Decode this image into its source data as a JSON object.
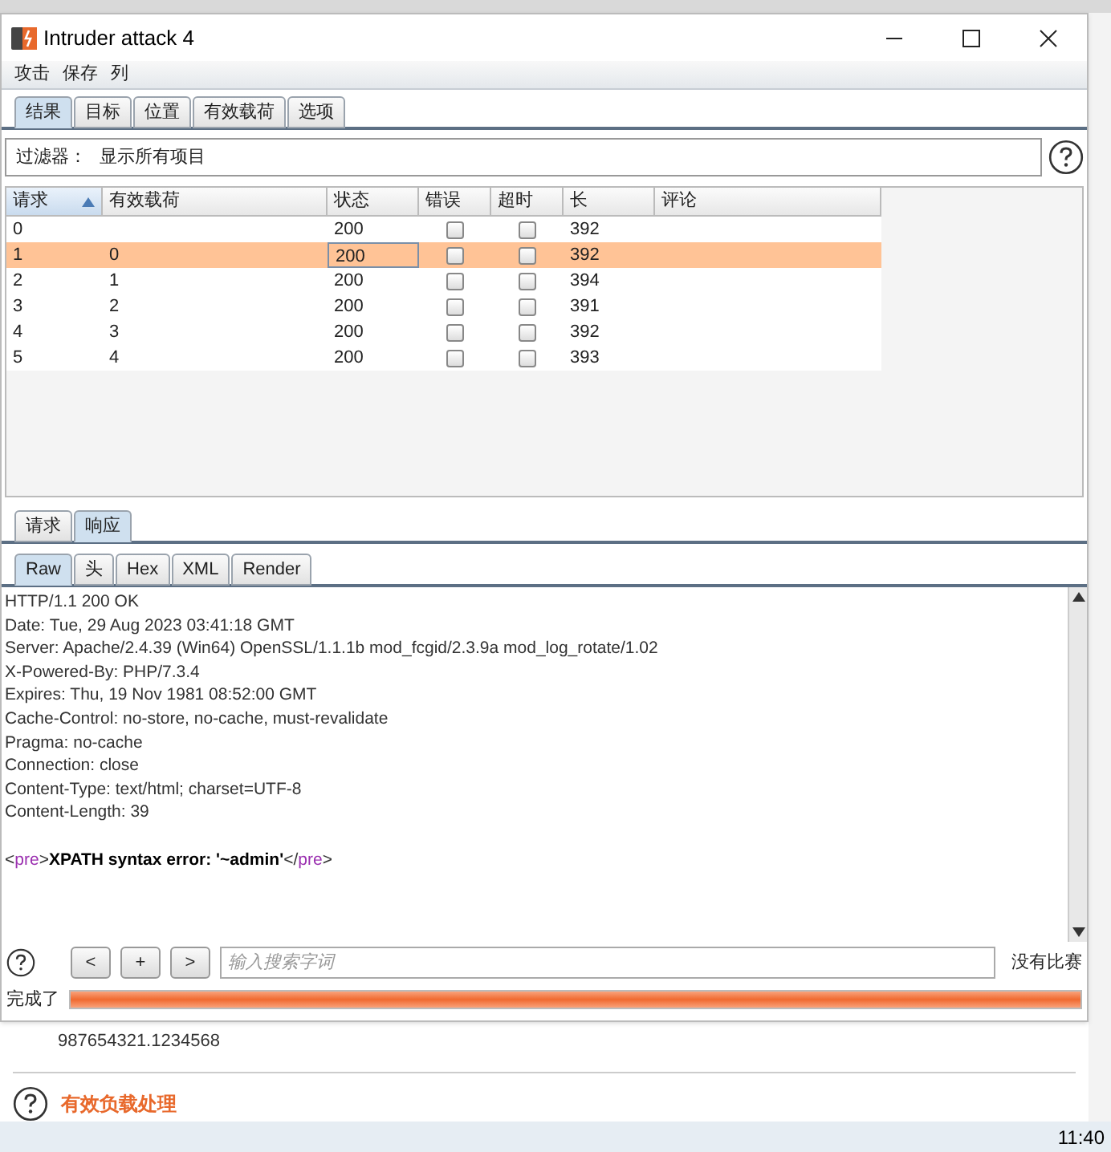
{
  "window": {
    "title": "Intruder attack 4"
  },
  "menu": [
    "攻击",
    "保存",
    "列"
  ],
  "tabs": [
    {
      "label": "结果",
      "selected": true
    },
    {
      "label": "目标",
      "selected": false
    },
    {
      "label": "位置",
      "selected": false
    },
    {
      "label": "有效载荷",
      "selected": false
    },
    {
      "label": "选项",
      "selected": false
    }
  ],
  "filter": {
    "label": "过滤器：",
    "value": "显示所有项目"
  },
  "table": {
    "columns": [
      {
        "label": "请求",
        "sorted": true
      },
      {
        "label": "有效载荷",
        "sorted": false
      },
      {
        "label": "状态",
        "sorted": false
      },
      {
        "label": "错误",
        "sorted": false
      },
      {
        "label": "超时",
        "sorted": false
      },
      {
        "label": "长",
        "sorted": false
      },
      {
        "label": "评论",
        "sorted": false
      }
    ],
    "rows": [
      {
        "request": "0",
        "status": "200",
        "error": false,
        "timeout": false,
        "length": "392",
        "selected": false
      },
      {
        "request": "1",
        "payload": "0",
        "status": "200",
        "error": false,
        "timeout": false,
        "length": "392",
        "selected": true
      },
      {
        "request": "2",
        "payload": "1",
        "status": "200",
        "error": false,
        "timeout": false,
        "length": "394",
        "selected": false
      },
      {
        "request": "3",
        "payload": "2",
        "status": "200",
        "error": false,
        "timeout": false,
        "length": "391",
        "selected": false
      },
      {
        "request": "4",
        "payload": "3",
        "status": "200",
        "error": false,
        "timeout": false,
        "length": "392",
        "selected": false
      },
      {
        "request": "5",
        "payload": "4",
        "status": "200",
        "error": false,
        "timeout": false,
        "length": "393",
        "selected": false
      }
    ]
  },
  "message_tabs": [
    {
      "label": "请求",
      "selected": false
    },
    {
      "label": "响应",
      "selected": true
    }
  ],
  "view_tabs": [
    {
      "label": "Raw",
      "selected": true
    },
    {
      "label": "头",
      "selected": false
    },
    {
      "label": "Hex",
      "selected": false
    },
    {
      "label": "XML",
      "selected": false
    },
    {
      "label": "Render",
      "selected": false
    }
  ],
  "response": [
    {
      "kind": "plain",
      "text": "HTTP/1.1 200 OK"
    },
    {
      "kind": "plain",
      "text": "Date: Tue, 29 Aug 2023 03:41:18 GMT"
    },
    {
      "kind": "plain",
      "text": "Server: Apache/2.4.39 (Win64) OpenSSL/1.1.1b mod_fcgid/2.3.9a mod_log_rotate/1.02"
    },
    {
      "kind": "plain",
      "text": "X-Powered-By: PHP/7.3.4"
    },
    {
      "kind": "plain",
      "text": "Expires: Thu, 19 Nov 1981 08:52:00 GMT"
    },
    {
      "kind": "plain",
      "text": "Cache-Control: no-store, no-cache, must-revalidate"
    },
    {
      "kind": "plain",
      "text": "Pragma: no-cache"
    },
    {
      "kind": "plain",
      "text": "Connection: close"
    },
    {
      "kind": "plain",
      "text": "Content-Type: text/html; charset=UTF-8"
    },
    {
      "kind": "plain",
      "text": "Content-Length: 39"
    },
    {
      "kind": "blank"
    },
    {
      "kind": "markup",
      "segments": [
        {
          "kind": "bracket",
          "text": "<"
        },
        {
          "kind": "tag",
          "text": "pre"
        },
        {
          "kind": "bracket",
          "text": ">"
        },
        {
          "kind": "bold",
          "text": "XPATH syntax error: '~admin'"
        },
        {
          "kind": "bracket",
          "text": "</"
        },
        {
          "kind": "tag",
          "text": "pre"
        },
        {
          "kind": "bracket",
          "text": ">"
        }
      ]
    }
  ],
  "search": {
    "buttons": [
      "<",
      "+",
      ">"
    ],
    "placeholder": "输入搜索字词",
    "result": "没有比赛"
  },
  "status": {
    "label": "完成了",
    "level": 1
  },
  "background": {
    "value": "987654321.1234568",
    "heading": "有效负载处理"
  },
  "taskbar": {
    "clock": "11:40"
  }
}
